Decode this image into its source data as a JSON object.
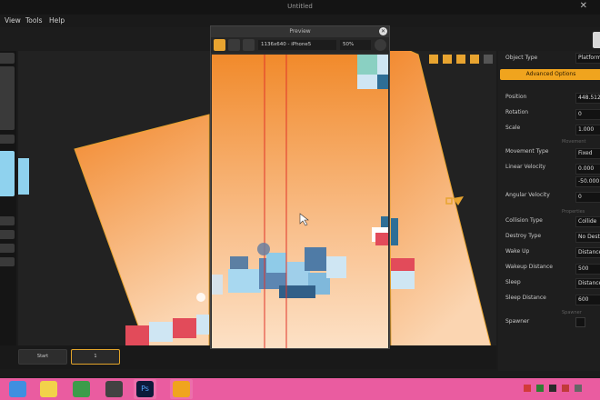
{
  "window": {
    "title": "Untitled"
  },
  "menu": [
    "View",
    "Tools",
    "Help"
  ],
  "preview": {
    "title": "Preview",
    "device": "1136x640 - iPhone5",
    "zoom": "50%"
  },
  "bottom": {
    "start_label": "Start",
    "tab_label": "1"
  },
  "panel": {
    "object_type_label": "Object Type",
    "object_type_value": "Platform",
    "advanced_button": "Advanced Options",
    "rows": [
      {
        "label": "Position",
        "value": "448.512"
      },
      {
        "label": "Rotation",
        "value": "0"
      },
      {
        "label": "Scale",
        "value": "1.000"
      },
      {
        "label": "Movement Type",
        "value": "Fixed"
      },
      {
        "label": "Linear Velocity",
        "value": "0.000"
      },
      {
        "label": "",
        "value": "-50.000"
      },
      {
        "label": "Angular Velocity",
        "value": "0"
      },
      {
        "label": "Collision Type",
        "value": "Collide"
      },
      {
        "label": "Destroy Type",
        "value": "No Destr"
      },
      {
        "label": "Wake Up",
        "value": "Distance"
      },
      {
        "label": "Wakeup Distance",
        "value": "500"
      },
      {
        "label": "Sleep",
        "value": "Distance"
      },
      {
        "label": "Sleep Distance",
        "value": "600"
      },
      {
        "label": "Spawner",
        "value": ""
      }
    ],
    "sections": [
      "Movement",
      "Properties",
      "Spawner"
    ]
  },
  "colors": {
    "accent": "#f0a41e",
    "taskbar": "#ea5ca0",
    "guide_line": "#e0342a"
  }
}
